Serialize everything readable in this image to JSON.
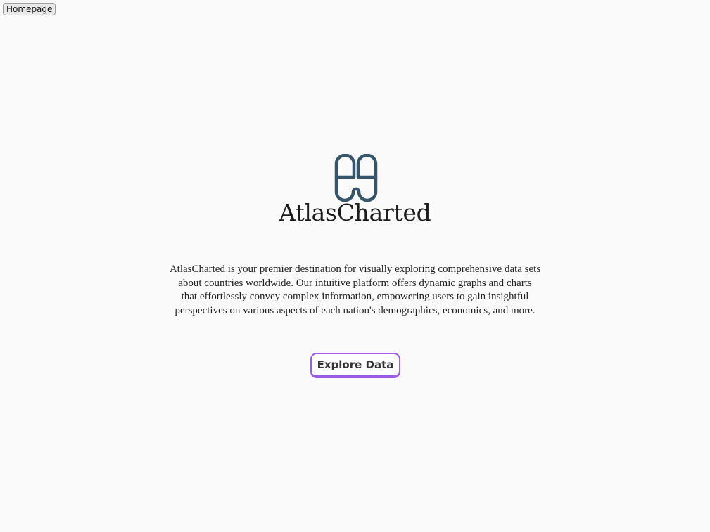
{
  "nav": {
    "homepage_label": "Homepage"
  },
  "brand": {
    "name": "AtlasCharted",
    "logo_icon": "atlas-logo-icon",
    "logo_color": "#36556b"
  },
  "description": {
    "lines": [
      "AtlasCharted is your premier destination for visually exploring  comprehensive data sets",
      "about countries worldwide. Our intuitive  platform offers dynamic graphs and charts",
      "that effortlessly convey  complex information, empowering users to gain insightful",
      "perspectives on  various aspects of each nation's demographics, economics, and more."
    ]
  },
  "cta": {
    "label": "Explore Data",
    "accent_color": "#9b5de5"
  }
}
